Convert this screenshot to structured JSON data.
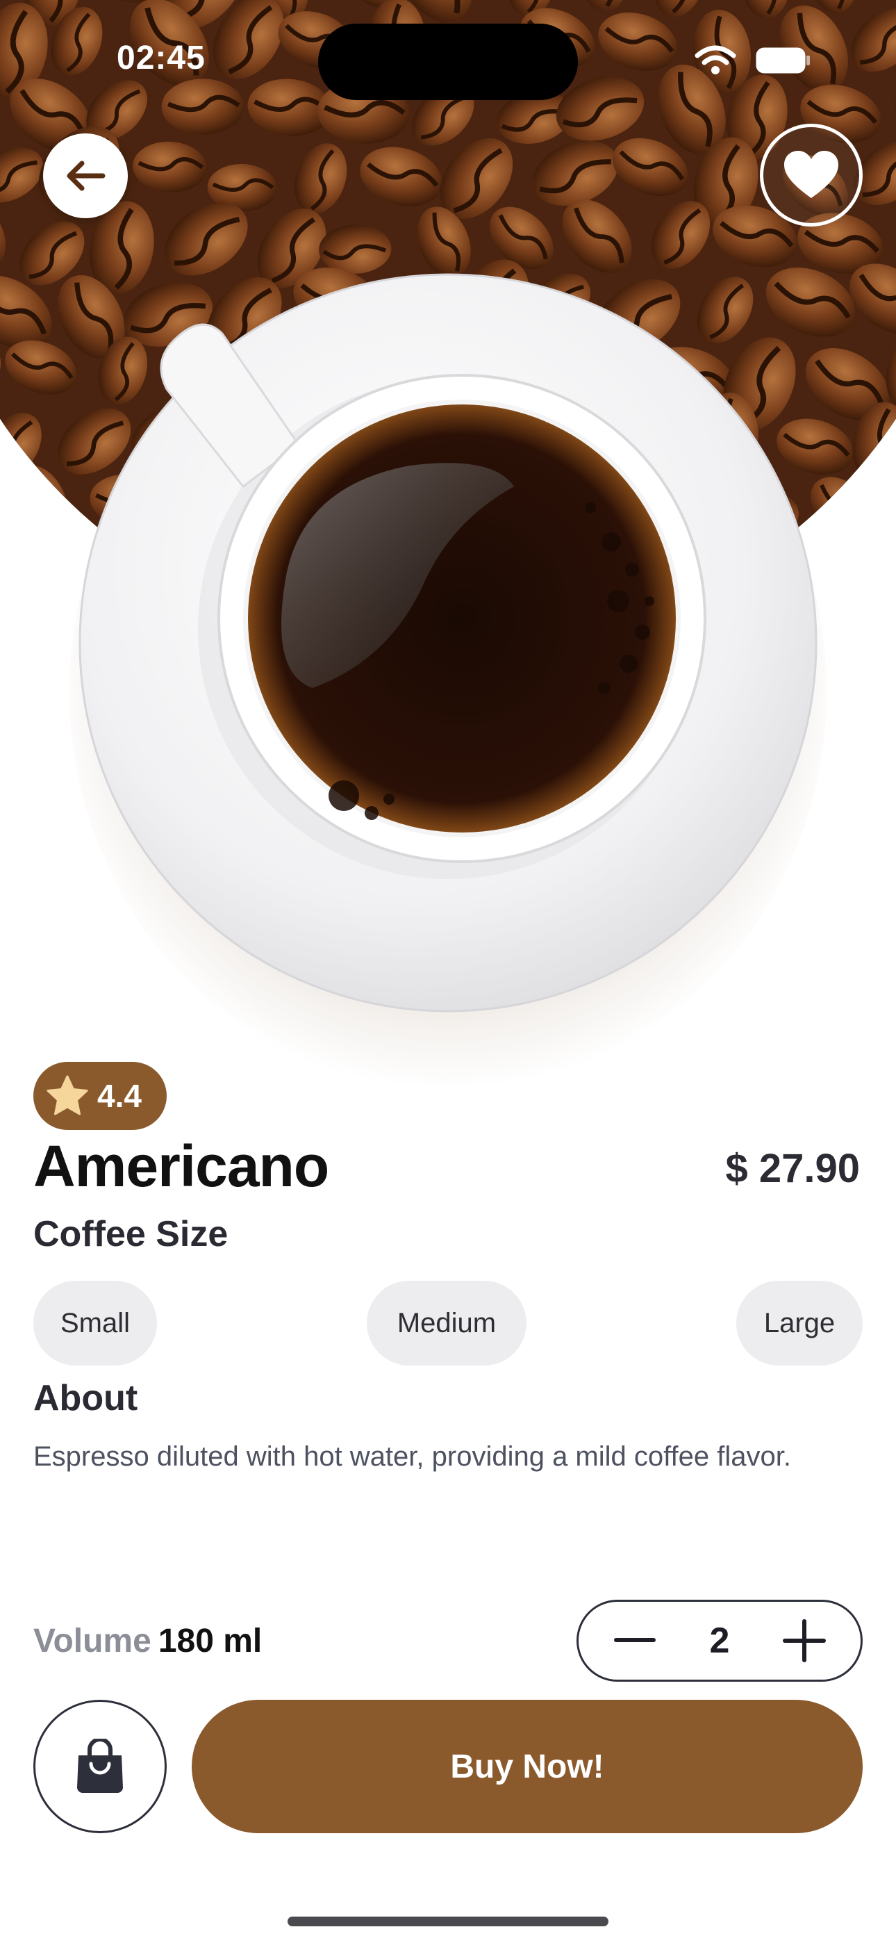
{
  "status_bar": {
    "time": "02:45"
  },
  "product": {
    "name": "Americano",
    "price": "$ 27.90",
    "rating": "4.4",
    "is_favorite": true
  },
  "size_section": {
    "label": "Coffee Size",
    "options": [
      "Small",
      "Medium",
      "Large"
    ]
  },
  "about": {
    "label": "About",
    "text": "Espresso diluted with hot water, providing a mild coffee flavor."
  },
  "volume": {
    "label": "Volume",
    "value": "180 ml"
  },
  "quantity": {
    "value": "2"
  },
  "actions": {
    "buy_label": "Buy Now!"
  },
  "icons": {
    "back": "arrow-left-icon",
    "favorite": "heart-icon",
    "rating": "star-icon",
    "cart": "shopping-bag-icon",
    "decrement": "minus-icon",
    "increment": "plus-icon",
    "wifi": "wifi-icon",
    "battery": "battery-icon"
  },
  "colors": {
    "accent": "#8a5a2d",
    "star": "#f6d69b",
    "text_primary": "#111111",
    "text_secondary": "#4d5160",
    "pill_bg": "#ededef"
  }
}
